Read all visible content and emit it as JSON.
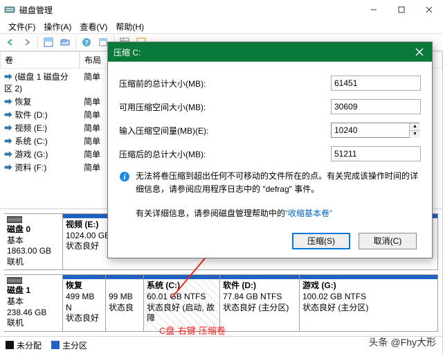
{
  "window": {
    "title": "磁盘管理",
    "menus": [
      "文件(F)",
      "操作(A)",
      "查看(V)",
      "帮助(H)"
    ],
    "list_headers": {
      "col1": "卷",
      "col2": "布局"
    },
    "volumes": [
      {
        "name": "(磁盘 1 磁盘分区 2)",
        "layout": "简单"
      },
      {
        "name": "恢复",
        "layout": "简单"
      },
      {
        "name": "软件 (D:)",
        "layout": "简单"
      },
      {
        "name": "视频 (E:)",
        "layout": "简单"
      },
      {
        "name": "系统 (C:)",
        "layout": "简单"
      },
      {
        "name": "游戏 (G:)",
        "layout": "简单"
      },
      {
        "name": "资料 (F:)",
        "layout": "简单"
      }
    ],
    "disk0": {
      "title": "磁盘 0",
      "type": "基本",
      "size": "1863.00 GB",
      "status": "联机",
      "part": {
        "title": "视频  (E:)",
        "size": "1024.00 GB",
        "status": "状态良好"
      }
    },
    "disk1": {
      "title": "磁盘 1",
      "type": "基本",
      "size": "238.46 GB",
      "status": "联机",
      "parts": [
        {
          "title": "恢复",
          "size": "499 MB N",
          "status": "状态良好"
        },
        {
          "title": "",
          "size": "99 MB",
          "status": "状态良"
        },
        {
          "title": "系统  (C:)",
          "size": "60.01 GB NTFS",
          "status": "状态良好 (启动, 故障"
        },
        {
          "title": "软件  (D:)",
          "size": "77.84 GB NTFS",
          "status": "状态良好 (主分区)"
        },
        {
          "title": "游戏  (G:)",
          "size": "100.02 GB NTFS",
          "status": "状态良好 (主分区)"
        }
      ]
    },
    "legend": {
      "unalloc": "未分配",
      "primary": "主分区"
    },
    "annotation": "C盘-右键-压缩卷",
    "watermark": "头条 @Fhy大形"
  },
  "dialog": {
    "title": "压缩 C:",
    "rows": {
      "before_label": "压缩前的总计大小(MB):",
      "before_val": "61451",
      "avail_label": "可用压缩空间大小(MB):",
      "avail_val": "30609",
      "input_label": "输入压缩空间量(MB)(E):",
      "input_val": "10240",
      "after_label": "压缩后的总计大小(MB):",
      "after_val": "51211"
    },
    "info1": "无法将卷压缩到超出任何不可移动的文件所在的点。有关完成该操作时间的详细信息，请参阅应用程序日志中的 \"defrag\" 事件。",
    "info2a": "有关详细信息，请参阅磁盘管理帮助中的",
    "info2b": "“收缩基本卷”",
    "ok": "压缩(S)",
    "cancel": "取消(C)"
  }
}
